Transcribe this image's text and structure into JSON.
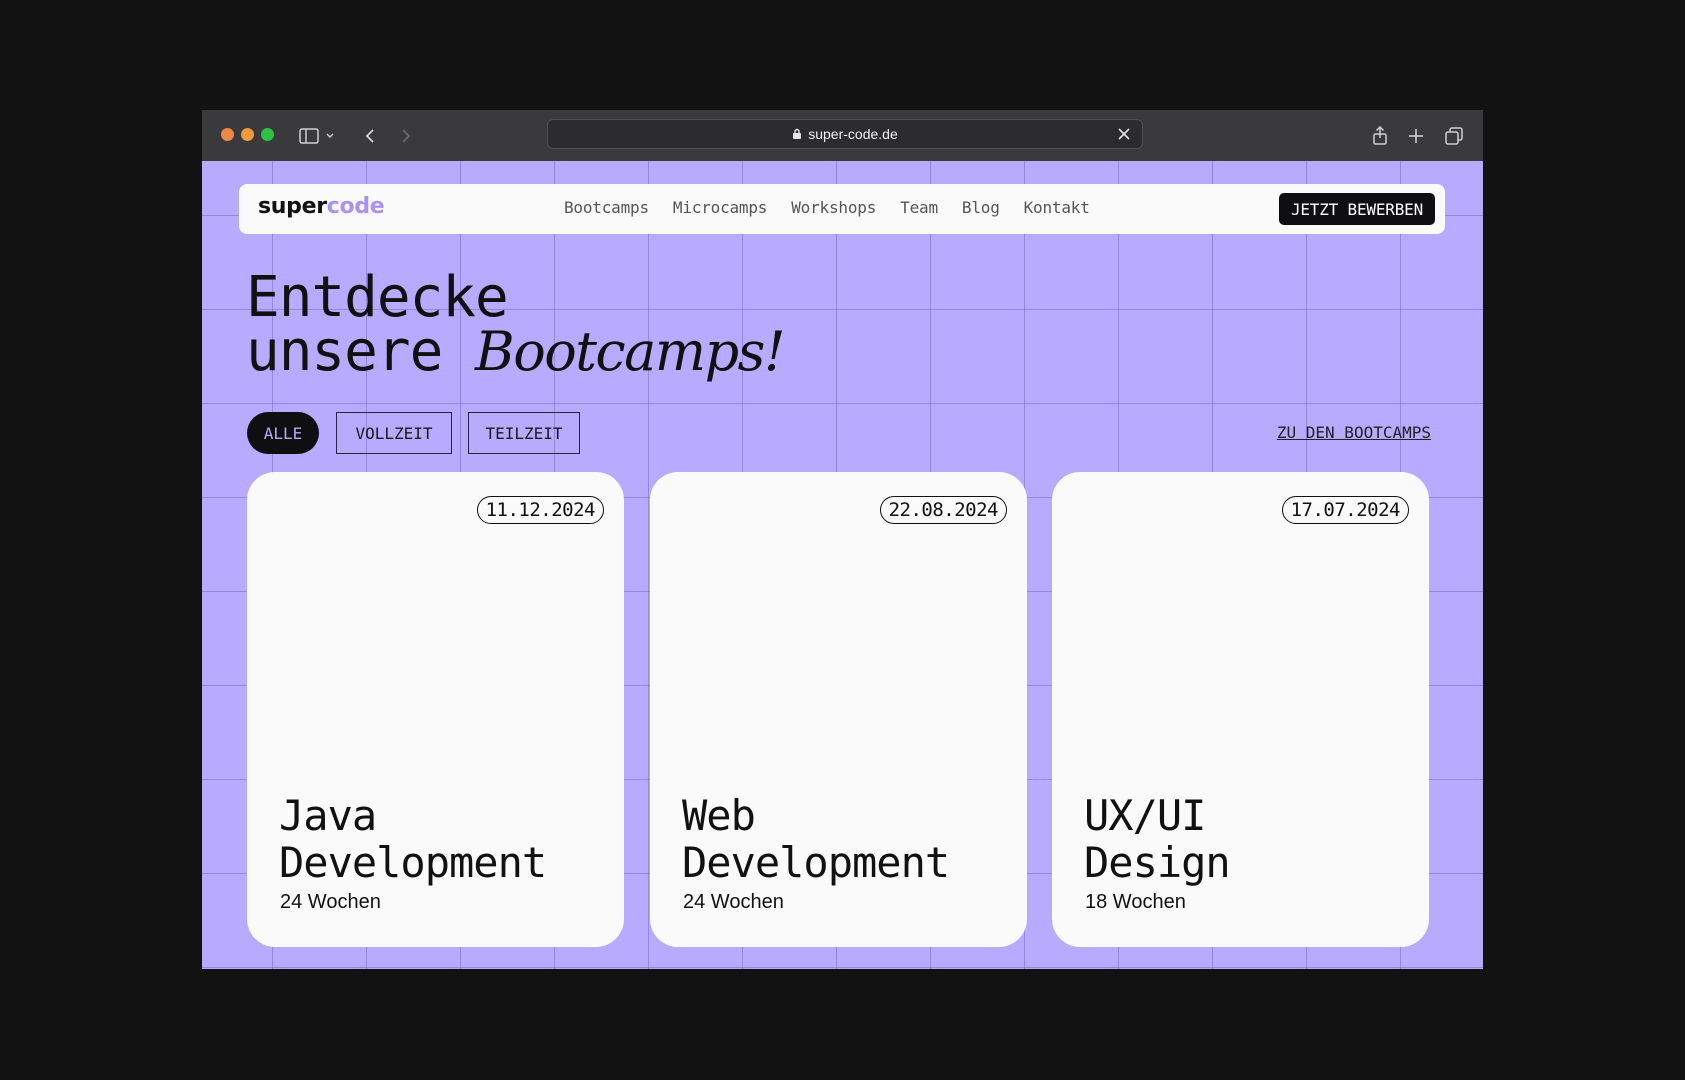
{
  "browser": {
    "url": "super-code.de"
  },
  "nav": {
    "logo_part1": "super",
    "logo_part2": "code",
    "links": [
      "Bootcamps",
      "Microcamps",
      "Workshops",
      "Team",
      "Blog",
      "Kontakt"
    ],
    "cta": "JETZT BEWERBEN"
  },
  "hero": {
    "line1": "Entdecke",
    "line2": "unsere ",
    "line2_italic": "Bootcamps!"
  },
  "filters": {
    "items": [
      "ALLE",
      "VOLLZEIT",
      "TEILZEIT"
    ],
    "active": "ALLE",
    "link": "ZU DEN BOOTCAMPS"
  },
  "cards": [
    {
      "date": "11.12.2024",
      "title_line1": "Java",
      "title_line2": "Development",
      "duration": "24 Wochen"
    },
    {
      "date": "22.08.2024",
      "title_line1": "Web",
      "title_line2": "Development",
      "duration": "24 Wochen"
    },
    {
      "date": "17.07.2024",
      "title_line1": "UX/UI",
      "title_line2": "Design",
      "duration": "18 Wochen"
    }
  ],
  "colors": {
    "background_accent": "#b8aaff",
    "logo_accent": "#a894f0",
    "dark": "#0f0f12",
    "card": "#fafafa"
  }
}
